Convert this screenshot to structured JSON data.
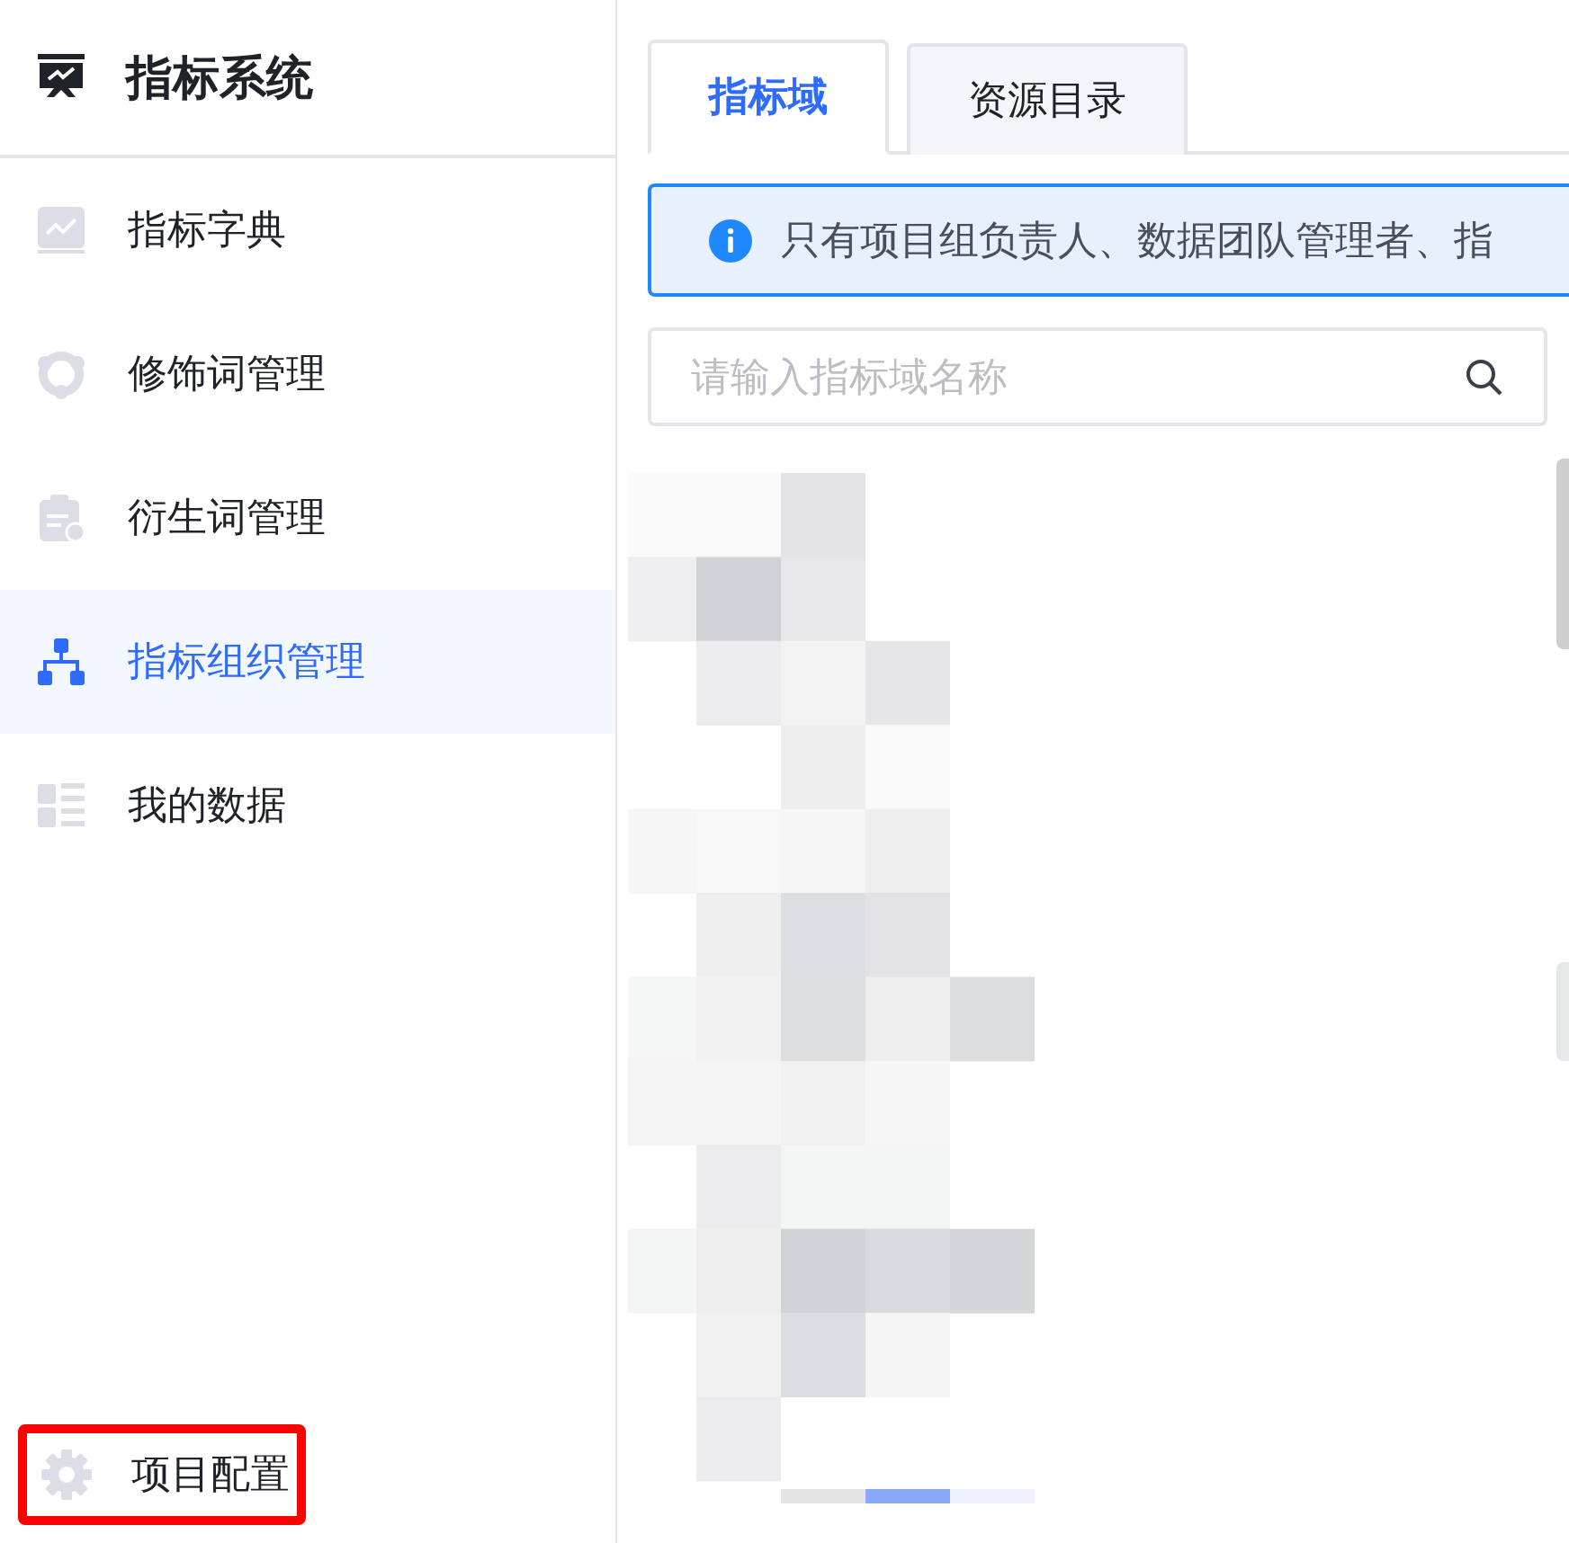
{
  "sidebar": {
    "title": "指标系统",
    "items": [
      {
        "label": "指标字典",
        "kind": "chart",
        "selected": false
      },
      {
        "label": "修饰词管理",
        "kind": "cycle",
        "selected": false
      },
      {
        "label": "衍生词管理",
        "kind": "clipboard",
        "selected": false
      },
      {
        "label": "指标组织管理",
        "kind": "org",
        "selected": true
      },
      {
        "label": "我的数据",
        "kind": "list",
        "selected": false
      }
    ],
    "footer_item": {
      "label": "项目配置",
      "kind": "gear",
      "highlighted": true
    }
  },
  "tabs": [
    {
      "label": "指标域",
      "selected": true
    },
    {
      "label": "资源目录",
      "selected": false
    }
  ],
  "alert": {
    "text": "只有项目组负责人、数据团队管理者、指"
  },
  "search": {
    "placeholder": "请输入指标域名称"
  }
}
